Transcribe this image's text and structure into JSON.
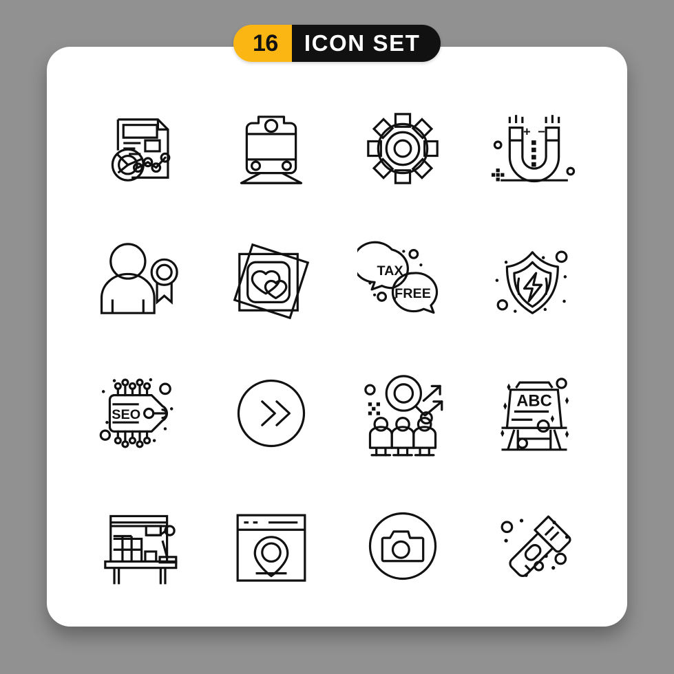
{
  "background_color": "#919191",
  "card_color": "#ffffff",
  "header": {
    "count": "16",
    "title": "ICON SET",
    "count_bg": "#FBB614",
    "count_fg": "#111111",
    "title_bg": "#111111",
    "title_fg": "#ffffff"
  },
  "grid": {
    "columns": 4,
    "rows": 4,
    "total": 16,
    "stroke_color": "#111111",
    "style": "line / outline"
  },
  "icons": [
    {
      "index": 1,
      "name": "report-analytics-document-icon",
      "label": "Report",
      "row": 1,
      "col": 1,
      "embedded_text": ""
    },
    {
      "index": 2,
      "name": "train-icon",
      "label": "Train",
      "row": 1,
      "col": 2,
      "embedded_text": ""
    },
    {
      "index": 3,
      "name": "gear-settings-icon",
      "label": "Gear",
      "row": 1,
      "col": 3,
      "embedded_text": ""
    },
    {
      "index": 4,
      "name": "magnet-icon",
      "label": "Magnet",
      "row": 1,
      "col": 4,
      "embedded_text": "+ -"
    },
    {
      "index": 5,
      "name": "user-award-icon",
      "label": "Award",
      "row": 2,
      "col": 1,
      "embedded_text": ""
    },
    {
      "index": 6,
      "name": "photo-frames-hearts-icon",
      "label": "Photos",
      "row": 2,
      "col": 2,
      "embedded_text": ""
    },
    {
      "index": 7,
      "name": "tax-free-speech-bubbles-icon",
      "label": "Tax Free",
      "row": 2,
      "col": 3,
      "embedded_text": "TAX FREE"
    },
    {
      "index": 8,
      "name": "shield-lightning-icon",
      "label": "Shield",
      "row": 2,
      "col": 4,
      "embedded_text": ""
    },
    {
      "index": 9,
      "name": "seo-chip-tag-icon",
      "label": "SEO",
      "row": 3,
      "col": 1,
      "embedded_text": "SEO"
    },
    {
      "index": 10,
      "name": "fast-forward-chevrons-icon",
      "label": "Forward",
      "row": 3,
      "col": 2,
      "embedded_text": ""
    },
    {
      "index": 11,
      "name": "candidate-search-icon",
      "label": "Search People",
      "row": 3,
      "col": 3,
      "embedded_text": ""
    },
    {
      "index": 12,
      "name": "abc-blackboard-icon",
      "label": "ABC Board",
      "row": 3,
      "col": 4,
      "embedded_text": "ABC"
    },
    {
      "index": 13,
      "name": "desk-workspace-lamp-icon",
      "label": "Workspace",
      "row": 4,
      "col": 1,
      "embedded_text": ""
    },
    {
      "index": 14,
      "name": "browser-location-pin-icon",
      "label": "Web Location",
      "row": 4,
      "col": 2,
      "embedded_text": ""
    },
    {
      "index": 15,
      "name": "camera-circle-icon",
      "label": "Camera",
      "row": 4,
      "col": 3,
      "embedded_text": ""
    },
    {
      "index": 16,
      "name": "flashlight-icon",
      "label": "Flashlight",
      "row": 4,
      "col": 4,
      "embedded_text": ""
    }
  ],
  "icon_texts": {
    "magnet_plus": "+",
    "magnet_minus": "−",
    "tax": "TAX",
    "free": "FREE",
    "seo": "SEO",
    "abc": "ABC"
  }
}
